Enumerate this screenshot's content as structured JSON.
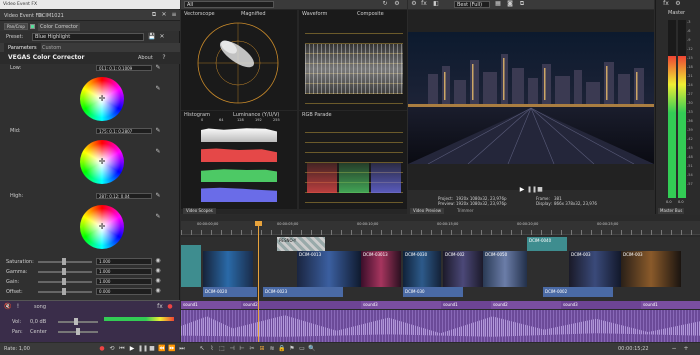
{
  "window": {
    "title": "Video Event FX"
  },
  "fx": {
    "event_label": "Video Event FX:",
    "event_name": "DCIM1021",
    "chain_btn": "Pan/Crop",
    "plugin": "Color Corrector",
    "preset_label": "Preset:",
    "preset_value": "Blue Highlight",
    "tabs": [
      "Parameters",
      "Custom"
    ],
    "about": "About",
    "header": "VEGAS Color Corrector",
    "sections": [
      {
        "label": "Low:",
        "value": "011; 0.1; 0.1009"
      },
      {
        "label": "Mid:",
        "value": "175; 0.1; 0.2807"
      },
      {
        "label": "High:",
        "value": "287; 0.12; 0.04"
      }
    ],
    "sliders": [
      {
        "label": "Saturation:",
        "value": "1.000"
      },
      {
        "label": "Gamma:",
        "value": "1.000"
      },
      {
        "label": "Gain:",
        "value": "1.000"
      },
      {
        "label": "Offset:",
        "value": "0.000"
      }
    ]
  },
  "scopes": {
    "dropdown": "All",
    "vectorscope": "Vectorscope",
    "vector_mode": "Magnified",
    "waveform": "Waveform",
    "wave_mode": "Composite",
    "histogram": "Histogram",
    "hist_mode": "Luminance (Y/U/V)",
    "rgb_parade": "RGB Parade",
    "tab": "Video Scopes",
    "ticks": [
      "0",
      "64",
      "128",
      "192",
      "255"
    ]
  },
  "preview": {
    "mode": "Best (Full)",
    "project_label": "Project:",
    "project_value": "1920x 1080x32, 23,976p",
    "preview_label": "Preview:",
    "preview_value": "1920x 1080x32, 23,976p",
    "display_label": "Display:",
    "display_value": "866x 378x32, 23,976",
    "frame_label": "Frame:",
    "frame_value": "381",
    "tabs": [
      "Video Preview",
      "Trimmer"
    ]
  },
  "master": {
    "label": "Master",
    "bus_tab": "Master Bus",
    "scale": [
      "-3",
      "-6",
      "-9",
      "-12",
      "-15",
      "-18",
      "-21",
      "-24",
      "-27",
      "-30",
      "-33",
      "-36",
      "-39",
      "-42",
      "-45",
      "-48",
      "-51",
      "-54",
      "-57"
    ],
    "level": 0.8,
    "values": [
      "0.0",
      "0.0"
    ]
  },
  "timeline": {
    "timecode": "00:00:15;22",
    "rate": "Rate: 1,00",
    "ruler": [
      "00:00:00;00",
      "00:00:05;00",
      "00:00:10;00",
      "00:00:15;00",
      "00:00:20;00",
      "00:00:25;00"
    ],
    "video_clips": [
      "PESNO-Y",
      "DCIM-0013",
      "DCIM-03013",
      "DCIM-0030",
      "DCIM-002",
      "DCIM-0050",
      "DCIM-0040",
      "DCIM-003",
      "DCIM-003"
    ],
    "sub_clips": [
      "DCIM-0020",
      "DCIM-0023",
      "DCIM-030",
      "DCIM-0002"
    ],
    "audio_clips": [
      "sound1",
      "sound2",
      "sound3",
      "sound1",
      "sound2",
      "sound3",
      "sound1"
    ],
    "audio_track": {
      "name": "song",
      "vol_label": "Vol:",
      "vol": "0,0 dB",
      "pan_label": "Pan:",
      "pan": "Center"
    }
  },
  "colors": {
    "teal": "#3e8d8f",
    "blue": "#4a6aa5",
    "audio": "#7a4ea0",
    "accent": "#e8a33c"
  }
}
